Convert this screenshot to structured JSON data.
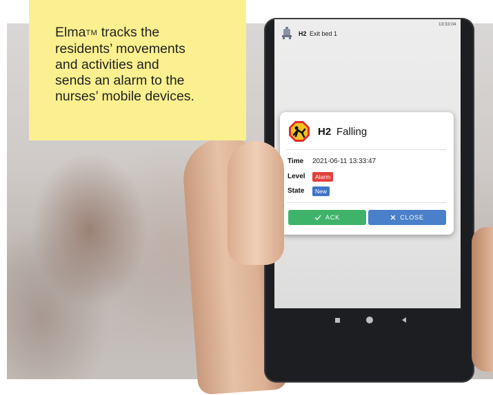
{
  "caption": {
    "line1_brand": "Elma",
    "line1_tm": "TM",
    "line1_rest": " tracks the",
    "line2": "residents’ movements",
    "line3": "and activities and",
    "line4": "sends an alarm to the",
    "line5": "nurses’ mobile devices."
  },
  "phone_topbar": {
    "icon": "bell-icon",
    "resident_id": "H2",
    "event": "Exit bed 1",
    "time": "13:33:04"
  },
  "alarm_card": {
    "icon": "person-falling-icon",
    "resident_id": "H2",
    "event": "Falling",
    "time_label": "Time",
    "time_value": "2021-06-11 13:33:47",
    "level_label": "Level",
    "level_value": "Alarm",
    "state_label": "State",
    "state_value": "New",
    "ack_label": "ACK",
    "close_label": "CLOSE",
    "colors": {
      "alarm": "#e0413c",
      "new": "#3f74c9",
      "ack": "#3fb36a",
      "close": "#4a7fc9",
      "icon_red": "#e02b2b",
      "icon_yellow": "#f4c21f"
    }
  },
  "android_nav": {
    "recent_icon": "square-icon",
    "home_icon": "circle-icon",
    "back_icon": "triangle-back-icon"
  }
}
